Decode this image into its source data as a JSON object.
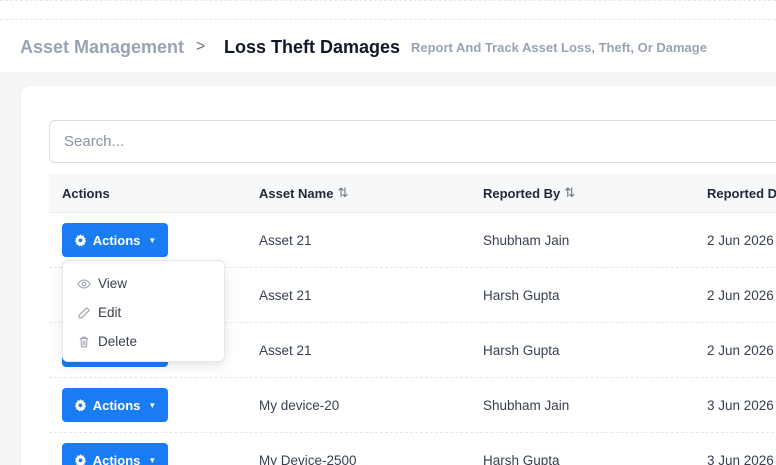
{
  "header": {
    "parent": "Asset Management",
    "separator": ">",
    "title": "Loss Theft Damages",
    "subtitle": "Report And Track Asset Loss, Theft, Or Damage"
  },
  "search": {
    "placeholder": "Search..."
  },
  "table": {
    "columns": [
      "Actions",
      "Asset Name",
      "Reported By",
      "Reported D"
    ],
    "sort_icon": "⇅",
    "action_label": "Actions",
    "rows": [
      {
        "asset": "Asset 21",
        "reported_by": "Shubham Jain",
        "date": "2 Jun 2026"
      },
      {
        "asset": "Asset 21",
        "reported_by": "Harsh Gupta",
        "date": "2 Jun 2026"
      },
      {
        "asset": "Asset 21",
        "reported_by": "Harsh Gupta",
        "date": "2 Jun 2026"
      },
      {
        "asset": "My device-20",
        "reported_by": "Shubham Jain",
        "date": "3 Jun 2026"
      },
      {
        "asset": "My Device-2500",
        "reported_by": "Harsh Gupta",
        "date": "3 Jun 2026"
      }
    ]
  },
  "menu": {
    "view": "View",
    "edit": "Edit",
    "delete": "Delete"
  },
  "colors": {
    "primary": "#1a7cf3"
  }
}
